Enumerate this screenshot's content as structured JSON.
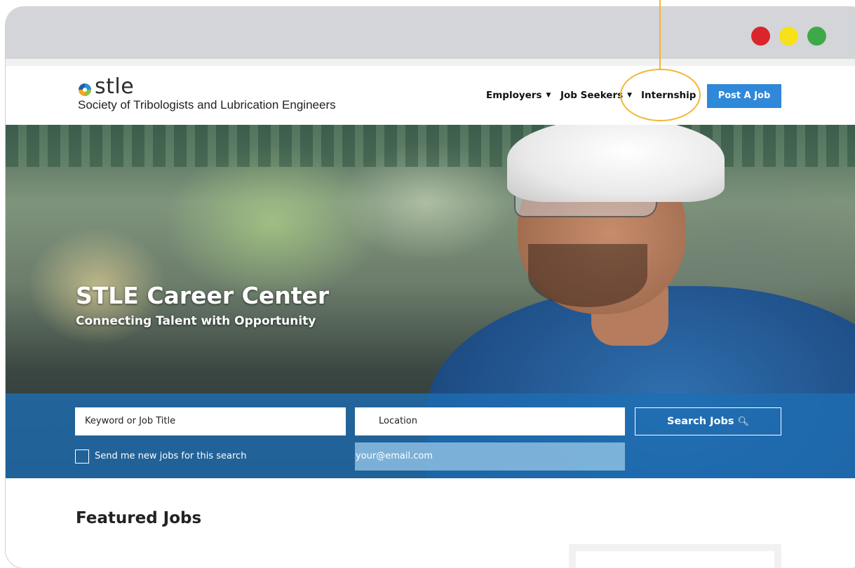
{
  "browser": {
    "traffic_lights": {
      "red": "#d9262b",
      "yellow": "#f6e11a",
      "green": "#3daa4a"
    }
  },
  "header": {
    "logo_word": "stle",
    "logo_tagline": "Society of Tribologists and Lubrication Engineers",
    "nav": {
      "employers": "Employers",
      "job_seekers": "Job Seekers",
      "internship": "Internship"
    },
    "post_job_label": "Post A Job",
    "colors": {
      "primary_button": "#2f88d8",
      "highlight_ring": "#f2b632"
    }
  },
  "hero": {
    "title": "STLE Career Center",
    "subtitle": "Connecting Talent with Opportunity",
    "search": {
      "keyword_placeholder": "Keyword or Job Title",
      "location_placeholder": "Location",
      "search_button": "Search Jobs",
      "alert_label": "Send me new jobs for this search",
      "email_placeholder": "your@email.com"
    }
  },
  "main": {
    "featured_title": "Featured Jobs"
  },
  "icons": {
    "caret": "caret-down-icon",
    "search": "magnifier-icon",
    "logo": "stle-swirl-logo"
  }
}
